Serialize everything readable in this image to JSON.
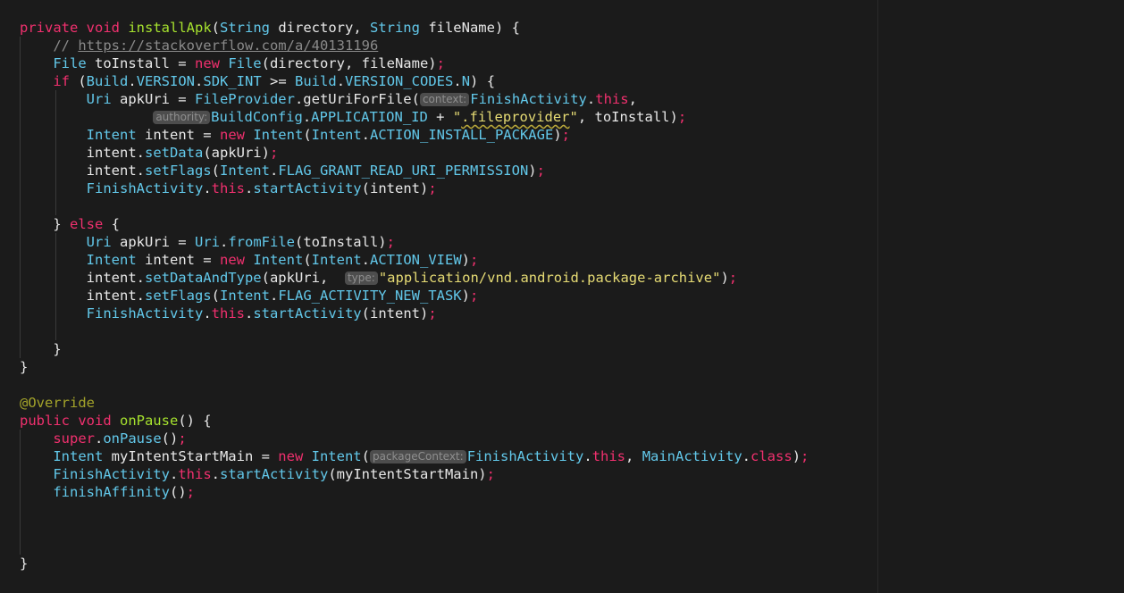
{
  "colors": {
    "background": "#1b1b1b",
    "keyword": "#f0306e",
    "type": "#62c8ea",
    "method": "#a6e22e",
    "string": "#e6db74",
    "comment": "#8a8a8a",
    "annotation": "#a3a32a",
    "hint_background": "#4d4d4d"
  },
  "code": {
    "lines": [
      {
        "indent": 0,
        "tokens": [
          [
            "kw",
            "private void "
          ],
          [
            "fn",
            "installApk"
          ],
          [
            "pl",
            "("
          ],
          [
            "ty",
            "String"
          ],
          [
            "pl",
            " directory, "
          ],
          [
            "ty",
            "String"
          ],
          [
            "pl",
            " fileName) {"
          ]
        ]
      },
      {
        "indent": 1,
        "tokens": [
          [
            "cm",
            "// "
          ],
          [
            "link",
            "https://stackoverflow.com/a/40131196"
          ]
        ]
      },
      {
        "indent": 1,
        "tokens": [
          [
            "ty",
            "File"
          ],
          [
            "pl",
            " toInstall = "
          ],
          [
            "kw",
            "new "
          ],
          [
            "ty",
            "File"
          ],
          [
            "pl",
            "(directory, fileName)"
          ],
          [
            "kw",
            ";"
          ]
        ]
      },
      {
        "indent": 1,
        "tokens": [
          [
            "kw",
            "if "
          ],
          [
            "pl",
            "("
          ],
          [
            "ty",
            "Build"
          ],
          [
            "pl",
            "."
          ],
          [
            "ty",
            "VERSION"
          ],
          [
            "pl",
            "."
          ],
          [
            "ty",
            "SDK_INT"
          ],
          [
            "pl",
            " >= "
          ],
          [
            "ty",
            "Build"
          ],
          [
            "pl",
            "."
          ],
          [
            "ty",
            "VERSION_CODES"
          ],
          [
            "pl",
            "."
          ],
          [
            "ty",
            "N"
          ],
          [
            "pl",
            ") {"
          ]
        ]
      },
      {
        "indent": 2,
        "tokens": [
          [
            "ty",
            "Uri"
          ],
          [
            "pl",
            " apkUri = "
          ],
          [
            "ty",
            "FileProvider"
          ],
          [
            "pl",
            ".getUriForFile("
          ],
          [
            "hint",
            "context:"
          ],
          [
            "ty",
            "FinishActivity"
          ],
          [
            "pl",
            "."
          ],
          [
            "kw",
            "this"
          ],
          [
            "pl",
            ","
          ]
        ]
      },
      {
        "indent": 2,
        "pad": 2,
        "tokens": [
          [
            "hint",
            "authority:"
          ],
          [
            "ty",
            "BuildConfig"
          ],
          [
            "pl",
            "."
          ],
          [
            "ty",
            "APPLICATION_ID"
          ],
          [
            "pl",
            " + "
          ],
          [
            "st",
            "\""
          ],
          [
            "squiggle",
            ".fileprovider"
          ],
          [
            "st",
            "\""
          ],
          [
            "pl",
            ", toInstall)"
          ],
          [
            "kw",
            ";"
          ]
        ]
      },
      {
        "indent": 2,
        "tokens": [
          [
            "ty",
            "Intent"
          ],
          [
            "pl",
            " intent = "
          ],
          [
            "kw",
            "new "
          ],
          [
            "ty",
            "Intent"
          ],
          [
            "pl",
            "("
          ],
          [
            "ty",
            "Intent"
          ],
          [
            "pl",
            "."
          ],
          [
            "ty",
            "ACTION_INSTALL_PACKAGE"
          ],
          [
            "pl",
            ")"
          ],
          [
            "kw",
            ";"
          ]
        ]
      },
      {
        "indent": 2,
        "tokens": [
          [
            "pl",
            "intent."
          ],
          [
            "ty",
            "setData"
          ],
          [
            "pl",
            "(apkUri)"
          ],
          [
            "kw",
            ";"
          ]
        ]
      },
      {
        "indent": 2,
        "tokens": [
          [
            "pl",
            "intent."
          ],
          [
            "ty",
            "setFlags"
          ],
          [
            "pl",
            "("
          ],
          [
            "ty",
            "Intent"
          ],
          [
            "pl",
            "."
          ],
          [
            "ty",
            "FLAG_GRANT_READ_URI_PERMISSION"
          ],
          [
            "pl",
            ")"
          ],
          [
            "kw",
            ";"
          ]
        ]
      },
      {
        "indent": 2,
        "tokens": [
          [
            "ty",
            "FinishActivity"
          ],
          [
            "pl",
            "."
          ],
          [
            "kw",
            "this"
          ],
          [
            "pl",
            "."
          ],
          [
            "ty",
            "startActivity"
          ],
          [
            "pl",
            "(intent)"
          ],
          [
            "kw",
            ";"
          ]
        ]
      },
      {
        "indent": 2,
        "tokens": []
      },
      {
        "indent": 1,
        "tokens": [
          [
            "pl",
            "} "
          ],
          [
            "kw",
            "else "
          ],
          [
            "pl",
            "{"
          ]
        ]
      },
      {
        "indent": 2,
        "tokens": [
          [
            "ty",
            "Uri"
          ],
          [
            "pl",
            " apkUri = "
          ],
          [
            "ty",
            "Uri"
          ],
          [
            "pl",
            "."
          ],
          [
            "ty",
            "fromFile"
          ],
          [
            "pl",
            "(toInstall)"
          ],
          [
            "kw",
            ";"
          ]
        ]
      },
      {
        "indent": 2,
        "tokens": [
          [
            "ty",
            "Intent"
          ],
          [
            "pl",
            " intent = "
          ],
          [
            "kw",
            "new "
          ],
          [
            "ty",
            "Intent"
          ],
          [
            "pl",
            "("
          ],
          [
            "ty",
            "Intent"
          ],
          [
            "pl",
            "."
          ],
          [
            "ty",
            "ACTION_VIEW"
          ],
          [
            "pl",
            ")"
          ],
          [
            "kw",
            ";"
          ]
        ]
      },
      {
        "indent": 2,
        "tokens": [
          [
            "pl",
            "intent."
          ],
          [
            "ty",
            "setDataAndType"
          ],
          [
            "pl",
            "(apkUri,  "
          ],
          [
            "hint",
            "type:"
          ],
          [
            "st",
            "\"application/vnd.android.package-archive\""
          ],
          [
            "pl",
            ")"
          ],
          [
            "kw",
            ";"
          ]
        ]
      },
      {
        "indent": 2,
        "tokens": [
          [
            "pl",
            "intent."
          ],
          [
            "ty",
            "setFlags"
          ],
          [
            "pl",
            "("
          ],
          [
            "ty",
            "Intent"
          ],
          [
            "pl",
            "."
          ],
          [
            "ty",
            "FLAG_ACTIVITY_NEW_TASK"
          ],
          [
            "pl",
            ")"
          ],
          [
            "kw",
            ";"
          ]
        ]
      },
      {
        "indent": 2,
        "tokens": [
          [
            "ty",
            "FinishActivity"
          ],
          [
            "pl",
            "."
          ],
          [
            "kw",
            "this"
          ],
          [
            "pl",
            "."
          ],
          [
            "ty",
            "startActivity"
          ],
          [
            "pl",
            "(intent)"
          ],
          [
            "kw",
            ";"
          ]
        ]
      },
      {
        "indent": 2,
        "tokens": []
      },
      {
        "indent": 1,
        "tokens": [
          [
            "pl",
            "}"
          ]
        ]
      },
      {
        "indent": 0,
        "tokens": [
          [
            "pl",
            "}"
          ]
        ]
      },
      {
        "indent": 0,
        "tokens": []
      },
      {
        "indent": 0,
        "tokens": [
          [
            "an",
            "@Override"
          ]
        ]
      },
      {
        "indent": 0,
        "tokens": [
          [
            "kw",
            "public void "
          ],
          [
            "fn",
            "onPause"
          ],
          [
            "pl",
            "() {"
          ]
        ]
      },
      {
        "indent": 1,
        "tokens": [
          [
            "kw",
            "super"
          ],
          [
            "pl",
            "."
          ],
          [
            "ty",
            "onPause"
          ],
          [
            "pl",
            "()"
          ],
          [
            "kw",
            ";"
          ]
        ]
      },
      {
        "indent": 1,
        "tokens": [
          [
            "ty",
            "Intent"
          ],
          [
            "pl",
            " myIntentStartMain = "
          ],
          [
            "kw",
            "new "
          ],
          [
            "ty",
            "Intent"
          ],
          [
            "pl",
            "("
          ],
          [
            "hint",
            "packageContext:"
          ],
          [
            "ty",
            "FinishActivity"
          ],
          [
            "pl",
            "."
          ],
          [
            "kw",
            "this"
          ],
          [
            "pl",
            ", "
          ],
          [
            "ty",
            "MainActivity"
          ],
          [
            "pl",
            "."
          ],
          [
            "kw",
            "class"
          ],
          [
            "pl",
            ")"
          ],
          [
            "kw",
            ";"
          ]
        ]
      },
      {
        "indent": 1,
        "tokens": [
          [
            "ty",
            "FinishActivity"
          ],
          [
            "pl",
            "."
          ],
          [
            "kw",
            "this"
          ],
          [
            "pl",
            "."
          ],
          [
            "ty",
            "startActivity"
          ],
          [
            "pl",
            "(myIntentStartMain)"
          ],
          [
            "kw",
            ";"
          ]
        ]
      },
      {
        "indent": 1,
        "tokens": [
          [
            "ty",
            "finishAffinity"
          ],
          [
            "pl",
            "()"
          ],
          [
            "kw",
            ";"
          ]
        ]
      },
      {
        "indent": 1,
        "tokens": []
      },
      {
        "indent": 1,
        "tokens": []
      },
      {
        "indent": 1,
        "tokens": []
      },
      {
        "indent": 0,
        "tokens": [
          [
            "pl",
            "}"
          ]
        ]
      }
    ]
  }
}
